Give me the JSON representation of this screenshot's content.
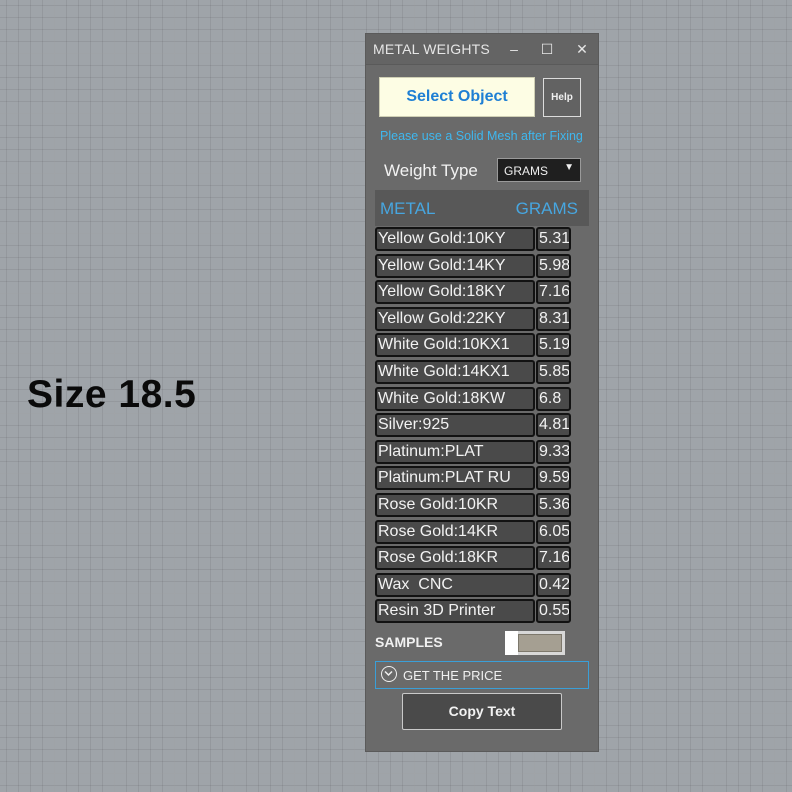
{
  "viewport": {
    "label": "Size 18.5"
  },
  "window": {
    "title": "METAL WEIGHTS",
    "minimize_glyph": "–",
    "maximize_glyph": "☐",
    "close_glyph": "✕"
  },
  "actions": {
    "select_object_label": "Select Object",
    "help_label": "Help",
    "hint": "Please use a Solid Mesh after Fixing"
  },
  "weight_type": {
    "label": "Weight Type",
    "selected": "GRAMS",
    "arrow": "▼"
  },
  "table": {
    "headers": {
      "metal": "METAL",
      "grams": "GRAMS"
    },
    "rows": [
      {
        "metal": "Yellow Gold:10KY",
        "grams": "5.31"
      },
      {
        "metal": "Yellow Gold:14KY",
        "grams": "5.98"
      },
      {
        "metal": "Yellow Gold:18KY",
        "grams": "7.16"
      },
      {
        "metal": "Yellow Gold:22KY",
        "grams": "8.31"
      },
      {
        "metal": "White Gold:10KX1",
        "grams": "5.19"
      },
      {
        "metal": "White Gold:14KX1",
        "grams": "5.85"
      },
      {
        "metal": "White Gold:18KW",
        "grams": "6.8"
      },
      {
        "metal": "Silver:925",
        "grams": "4.81"
      },
      {
        "metal": "Platinum:PLAT",
        "grams": "9.33"
      },
      {
        "metal": "Platinum:PLAT RU",
        "grams": "9.59"
      },
      {
        "metal": "Rose Gold:10KR",
        "grams": "5.36"
      },
      {
        "metal": "Rose Gold:14KR",
        "grams": "6.05"
      },
      {
        "metal": "Rose Gold:18KR",
        "grams": "7.16"
      },
      {
        "metal": "Wax  CNC",
        "grams": "0.42"
      },
      {
        "metal": "Resin 3D Printer",
        "grams": "0.55"
      }
    ]
  },
  "samples": {
    "label": "SAMPLES",
    "enabled": false
  },
  "price": {
    "label": "GET THE PRICE"
  },
  "copy": {
    "label": "Copy Text"
  },
  "colors": {
    "panel_bg": "#6a6a6a",
    "accent_blue": "#47a6e0",
    "hint_blue": "#3fb7ee",
    "select_button_bg": "#fdfde4"
  }
}
